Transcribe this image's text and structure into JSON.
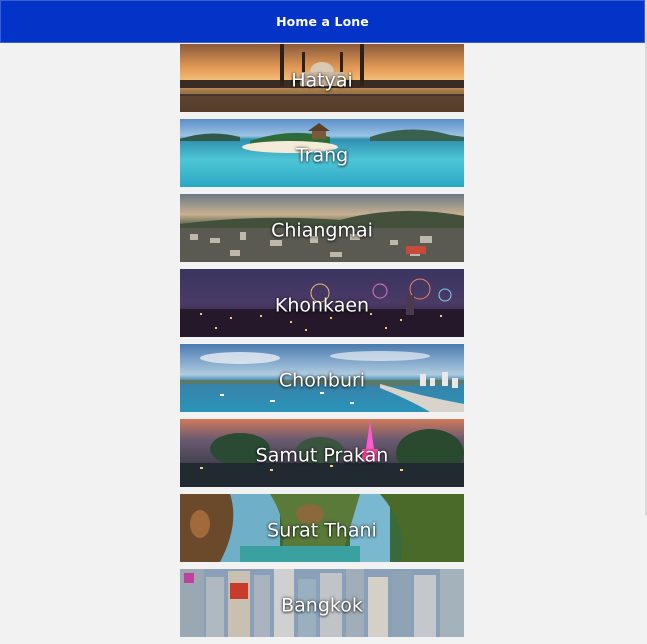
{
  "header": {
    "title": "Home a Lone",
    "background": "#0433c8"
  },
  "places": [
    {
      "name": "Hatyai",
      "scene": "mosque-sunset"
    },
    {
      "name": "Trang",
      "scene": "tropical-beach"
    },
    {
      "name": "Chiangmai",
      "scene": "city-mountain-dusk"
    },
    {
      "name": "Khonkaen",
      "scene": "city-fireworks-night"
    },
    {
      "name": "Chonburi",
      "scene": "coastal-city-bay"
    },
    {
      "name": "Samut Prakan",
      "scene": "pink-tower-river"
    },
    {
      "name": "Surat Thani",
      "scene": "limestone-cliffs"
    },
    {
      "name": "Bangkok",
      "scene": "city-buildings"
    }
  ]
}
